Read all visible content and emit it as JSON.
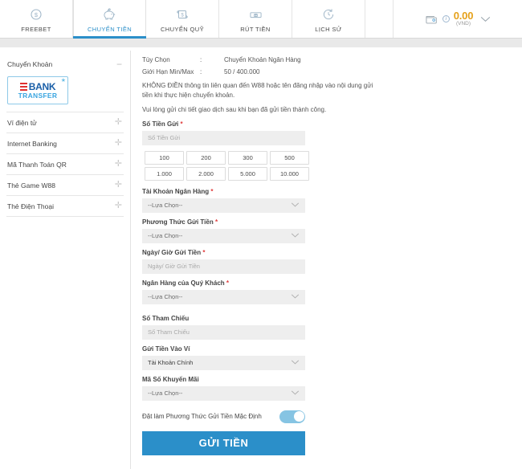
{
  "nav": {
    "tabs": [
      {
        "label": "FREEBET",
        "icon": "coin-dollar-icon",
        "active": false
      },
      {
        "label": "CHUYỂN TIỀN",
        "icon": "piggy-bank-icon",
        "active": true
      },
      {
        "label": "CHUYỂN QUỸ",
        "icon": "transfer-funds-icon",
        "active": false
      },
      {
        "label": "RÚT TIỀN",
        "icon": "withdraw-cash-icon",
        "active": false
      },
      {
        "label": "LỊCH SỬ",
        "icon": "clock-history-icon",
        "active": false
      }
    ],
    "balance": {
      "amount": "0.00",
      "currency": "(VND)",
      "wallet_icon": "wallet-icon",
      "info_icon": "info-icon",
      "chevron_icon": "chevron-down-icon"
    }
  },
  "sidebar": {
    "items": [
      {
        "label": "Chuyển Khoản",
        "state": "expanded",
        "toggle_icon": "minus-icon"
      },
      {
        "label": "Ví điện tử",
        "state": "collapsed",
        "toggle_icon": "plus-icon"
      },
      {
        "label": "Internet Banking",
        "state": "collapsed",
        "toggle_icon": "plus-icon"
      },
      {
        "label": "Mã Thanh Toán QR",
        "state": "collapsed",
        "toggle_icon": "plus-icon"
      },
      {
        "label": "Thẻ Game W88",
        "state": "collapsed",
        "toggle_icon": "plus-icon"
      },
      {
        "label": "Thẻ Điện Thoại",
        "state": "collapsed",
        "toggle_icon": "plus-icon"
      }
    ],
    "logo": {
      "name": "ebank-transfer-logo",
      "line1": "BANK",
      "line2": "TRANSFER",
      "star": "★"
    }
  },
  "main": {
    "info": {
      "option_label": "Tùy Chọn",
      "option_sep": ":",
      "option_value": "Chuyển Khoản Ngân Hàng",
      "limit_label": "Giới Hạn Min/Max",
      "limit_sep": ":",
      "limit_value": "50 / 400.000",
      "warning": "KHÔNG ĐIỀN thông tin liên quan đến W88 hoặc tên đăng nhập vào nội dung gửi tiền khi thực hiện chuyển khoản.",
      "note": "Vui lòng gửi chi tiết giao dịch sau khi bạn đã gửi tiền thành công."
    },
    "amount_field": {
      "label": "Số Tiền Gửi",
      "required": "*",
      "placeholder": "Số Tiền Gửi",
      "value": ""
    },
    "quick_amounts": [
      "100",
      "200",
      "300",
      "500",
      "1.000",
      "2.000",
      "5.000",
      "10.000"
    ],
    "fields": [
      {
        "name": "bank-account",
        "label": "Tài Khoản Ngân Hàng",
        "required": "*",
        "type": "select",
        "value": "--Lựa Chọn--",
        "dark": false
      },
      {
        "name": "deposit-method",
        "label": "Phương Thức Gửi Tiền",
        "required": "*",
        "type": "select",
        "value": "--Lựa Chọn--",
        "dark": false
      },
      {
        "name": "deposit-datetime",
        "label": "Ngày/ Giờ Gửi Tiền",
        "required": "*",
        "type": "input",
        "placeholder": "Ngày/ Giờ Gửi Tiền",
        "value": ""
      },
      {
        "name": "customer-bank",
        "label": "Ngân Hàng của Quý Khách",
        "required": "*",
        "type": "select",
        "value": "--Lựa Chọn--",
        "dark": false
      },
      {
        "name": "reference-number",
        "label": "Số Tham Chiếu",
        "required": "",
        "type": "input",
        "placeholder": "Số Tham Chiếu",
        "value": ""
      },
      {
        "name": "deposit-to-wallet",
        "label": "Gửi Tiền Vào Ví",
        "required": "",
        "type": "select",
        "value": "Tài Khoản Chính",
        "dark": true
      },
      {
        "name": "promo-code",
        "label": "Mã Số Khuyến Mãi",
        "required": "",
        "type": "select",
        "value": "--Lựa Chọn--",
        "dark": false
      }
    ],
    "default_toggle": {
      "label": "Đặt làm Phương Thức Gửi Tiền Mặc Định",
      "on": true
    },
    "submit_label": "GỬI TIỀN"
  },
  "colors": {
    "accent_blue": "#2b8fc9",
    "toggle_on": "#86c4e3",
    "balance_gold": "#e5a11b",
    "required_red": "#e03b3b",
    "field_bg": "#eeeeee"
  }
}
